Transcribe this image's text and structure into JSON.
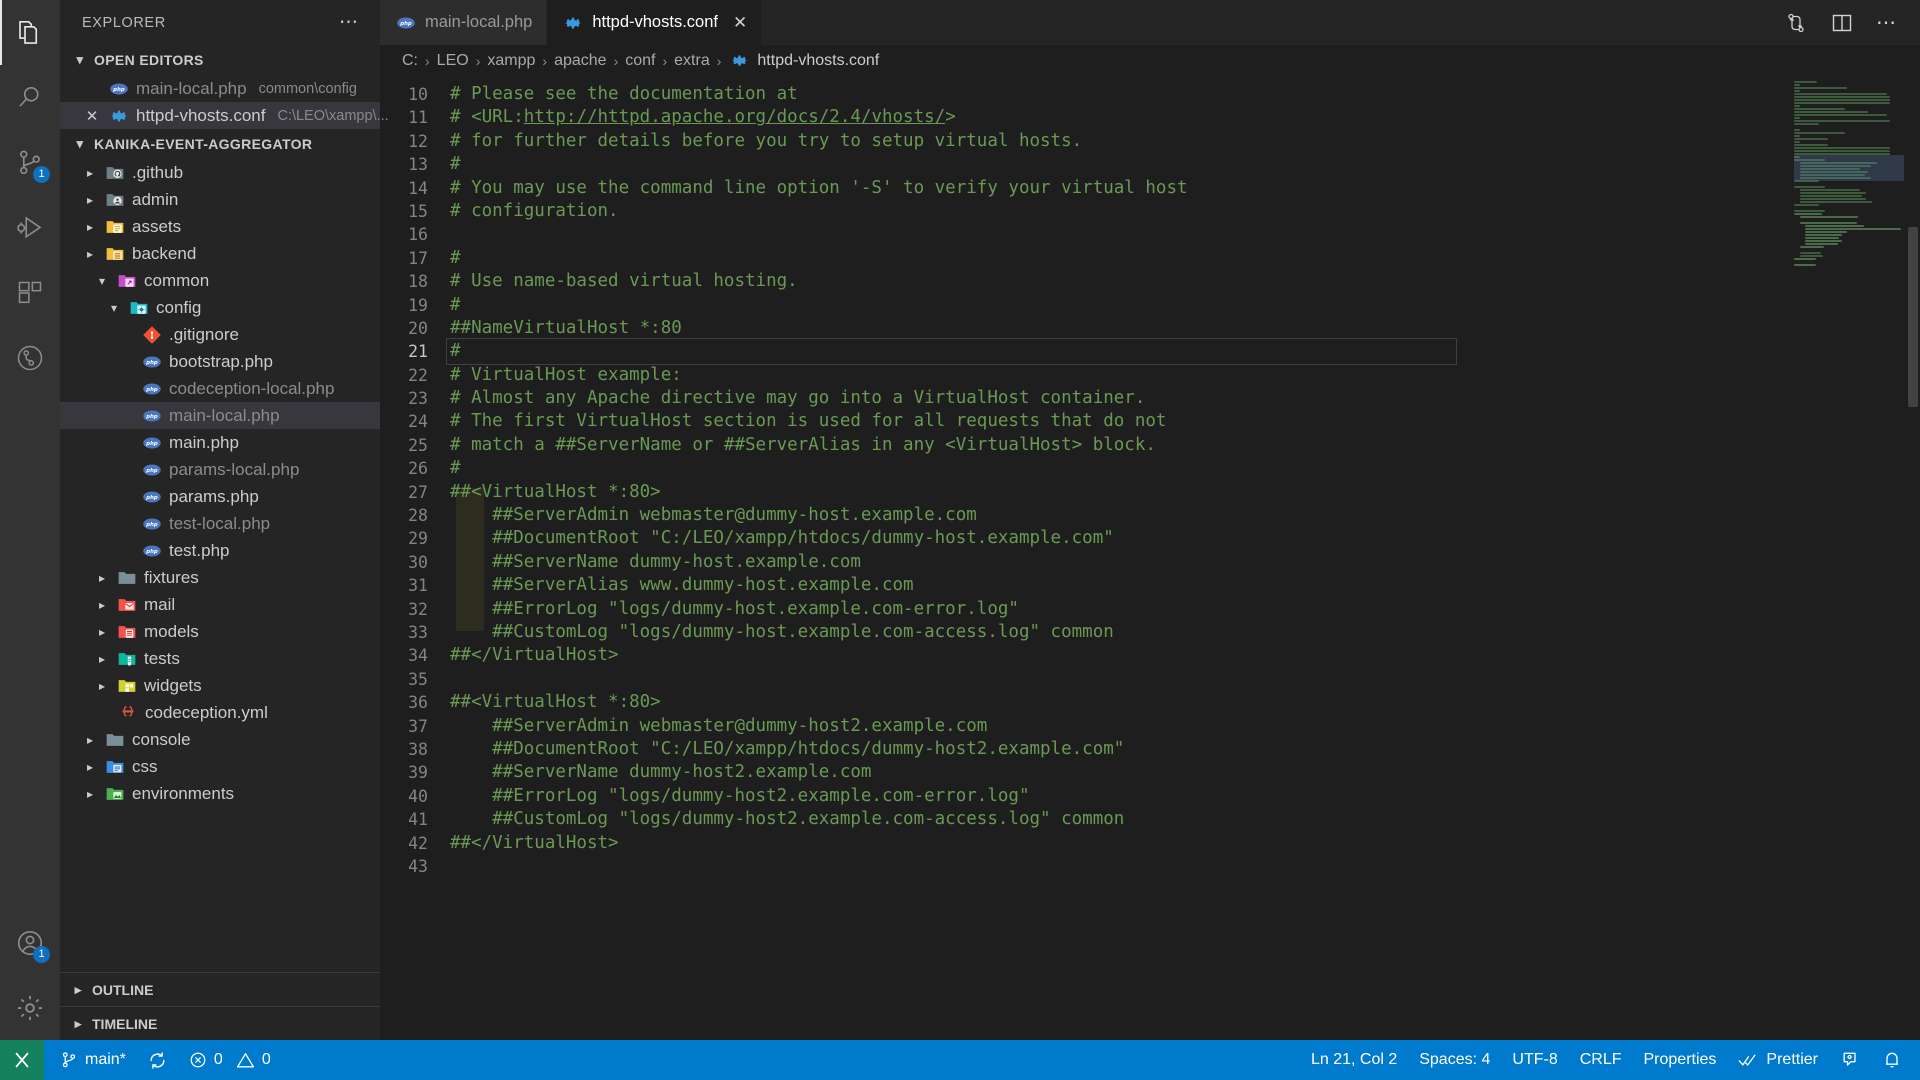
{
  "activity_bar": {
    "items": [
      {
        "name": "explorer-icon",
        "label": "Explorer",
        "active": true,
        "badge": ""
      },
      {
        "name": "search-icon",
        "label": "Search",
        "active": false,
        "badge": ""
      },
      {
        "name": "source-control-icon",
        "label": "Source Control",
        "active": false,
        "badge": "1"
      },
      {
        "name": "run-debug-icon",
        "label": "Run and Debug",
        "active": false,
        "badge": ""
      },
      {
        "name": "extensions-icon",
        "label": "Extensions",
        "active": false,
        "badge": ""
      },
      {
        "name": "git-graph-icon",
        "label": "Git Graph",
        "active": false,
        "badge": ""
      }
    ],
    "bottom_items": [
      {
        "name": "account-icon",
        "label": "Accounts",
        "badge": "1"
      },
      {
        "name": "settings-gear-icon",
        "label": "Manage",
        "badge": ""
      }
    ]
  },
  "sidebar": {
    "title": "EXPLORER",
    "more_actions": "⋯",
    "open_editors": {
      "label": "OPEN EDITORS",
      "expanded": true,
      "items": [
        {
          "name": "main-local.php",
          "detail": "common\\config",
          "icon": "php-icon",
          "dim": true,
          "selected": false,
          "dirty": false
        },
        {
          "name": "httpd-vhosts.conf",
          "detail": "C:\\LEO\\xampp\\...",
          "icon": "gear-icon",
          "dim": false,
          "selected": true,
          "dirty": false
        }
      ]
    },
    "workspace": {
      "label": "KANIKA-EVENT-AGGREGATOR",
      "expanded": true,
      "tree": [
        {
          "label": ".github",
          "type": "folder",
          "icon": "github-folder-icon",
          "indent": 1,
          "expanded": false,
          "dim": false
        },
        {
          "label": "admin",
          "type": "folder",
          "icon": "admin-folder-icon",
          "indent": 1,
          "expanded": false,
          "dim": false
        },
        {
          "label": "assets",
          "type": "folder",
          "icon": "assets-folder-icon",
          "indent": 1,
          "expanded": false,
          "dim": false
        },
        {
          "label": "backend",
          "type": "folder",
          "icon": "backend-folder-icon",
          "indent": 1,
          "expanded": false,
          "dim": false
        },
        {
          "label": "common",
          "type": "folder",
          "icon": "common-folder-icon",
          "indent": 1,
          "expanded": true,
          "dim": false
        },
        {
          "label": "config",
          "type": "folder",
          "icon": "config-folder-icon",
          "indent": 2,
          "expanded": true,
          "dim": false
        },
        {
          "label": ".gitignore",
          "type": "file",
          "icon": "git-icon",
          "indent": 3,
          "dim": false
        },
        {
          "label": "bootstrap.php",
          "type": "file",
          "icon": "php-icon",
          "indent": 3,
          "dim": false
        },
        {
          "label": "codeception-local.php",
          "type": "file",
          "icon": "php-icon",
          "indent": 3,
          "dim": true
        },
        {
          "label": "main-local.php",
          "type": "file",
          "icon": "php-icon",
          "indent": 3,
          "dim": true,
          "selected": true
        },
        {
          "label": "main.php",
          "type": "file",
          "icon": "php-icon",
          "indent": 3,
          "dim": false
        },
        {
          "label": "params-local.php",
          "type": "file",
          "icon": "php-icon",
          "indent": 3,
          "dim": true
        },
        {
          "label": "params.php",
          "type": "file",
          "icon": "php-icon",
          "indent": 3,
          "dim": false
        },
        {
          "label": "test-local.php",
          "type": "file",
          "icon": "php-icon",
          "indent": 3,
          "dim": true
        },
        {
          "label": "test.php",
          "type": "file",
          "icon": "php-icon",
          "indent": 3,
          "dim": false
        },
        {
          "label": "fixtures",
          "type": "folder",
          "icon": "plain-folder-icon",
          "indent": 2,
          "expanded": false,
          "dim": false
        },
        {
          "label": "mail",
          "type": "folder",
          "icon": "mail-folder-icon",
          "indent": 2,
          "expanded": false,
          "dim": false
        },
        {
          "label": "models",
          "type": "folder",
          "icon": "models-folder-icon",
          "indent": 2,
          "expanded": false,
          "dim": false
        },
        {
          "label": "tests",
          "type": "folder",
          "icon": "tests-folder-icon",
          "indent": 2,
          "expanded": false,
          "dim": false
        },
        {
          "label": "widgets",
          "type": "folder",
          "icon": "widgets-folder-icon",
          "indent": 2,
          "expanded": false,
          "dim": false
        },
        {
          "label": "codeception.yml",
          "type": "file",
          "icon": "yaml-icon",
          "indent": 2,
          "dim": false
        },
        {
          "label": "console",
          "type": "folder",
          "icon": "plain-folder-icon",
          "indent": 1,
          "expanded": false,
          "dim": false
        },
        {
          "label": "css",
          "type": "folder",
          "icon": "css-folder-icon",
          "indent": 1,
          "expanded": false,
          "dim": false
        },
        {
          "label": "environments",
          "type": "folder",
          "icon": "env-folder-icon",
          "indent": 1,
          "expanded": false,
          "dim": false
        }
      ]
    },
    "outline_label": "OUTLINE",
    "timeline_label": "TIMELINE"
  },
  "tabs": [
    {
      "label": "main-local.php",
      "icon": "php-icon",
      "active": false,
      "closable": false
    },
    {
      "label": "httpd-vhosts.conf",
      "icon": "gear-icon",
      "active": true,
      "closable": true,
      "close": "✕"
    }
  ],
  "tab_actions": [
    {
      "name": "split-source-control-icon",
      "label": "Open Changes"
    },
    {
      "name": "split-editor-icon",
      "label": "Split Editor Right"
    },
    {
      "name": "more-actions-icon",
      "label": "More Actions..."
    }
  ],
  "breadcrumb": {
    "separator": "›",
    "crumbs": [
      "C:",
      "LEO",
      "xampp",
      "apache",
      "conf",
      "extra"
    ],
    "file": "httpd-vhosts.conf",
    "file_icon": "gear-icon"
  },
  "editor": {
    "first_line_number": 10,
    "current_line": 21,
    "indent_guide_lines": [
      28,
      29,
      30,
      31,
      32,
      33
    ],
    "lines": [
      {
        "n": 10,
        "text": "# Please see the documentation at"
      },
      {
        "n": 11,
        "text": "# <URL:http://httpd.apache.org/docs/2.4/vhosts/>",
        "link": "http://httpd.apache.org/docs/2.4/vhosts/"
      },
      {
        "n": 12,
        "text": "# for further details before you try to setup virtual hosts."
      },
      {
        "n": 13,
        "text": "#"
      },
      {
        "n": 14,
        "text": "# You may use the command line option '-S' to verify your virtual host"
      },
      {
        "n": 15,
        "text": "# configuration."
      },
      {
        "n": 16,
        "text": ""
      },
      {
        "n": 17,
        "text": "#"
      },
      {
        "n": 18,
        "text": "# Use name-based virtual hosting."
      },
      {
        "n": 19,
        "text": "#"
      },
      {
        "n": 20,
        "text": "##NameVirtualHost *:80"
      },
      {
        "n": 21,
        "text": "#"
      },
      {
        "n": 22,
        "text": "# VirtualHost example:"
      },
      {
        "n": 23,
        "text": "# Almost any Apache directive may go into a VirtualHost container."
      },
      {
        "n": 24,
        "text": "# The first VirtualHost section is used for all requests that do not"
      },
      {
        "n": 25,
        "text": "# match a ##ServerName or ##ServerAlias in any <VirtualHost> block."
      },
      {
        "n": 26,
        "text": "#"
      },
      {
        "n": 27,
        "text": "##<VirtualHost *:80>"
      },
      {
        "n": 28,
        "text": "    ##ServerAdmin webmaster@dummy-host.example.com"
      },
      {
        "n": 29,
        "text": "    ##DocumentRoot \"C:/LEO/xampp/htdocs/dummy-host.example.com\""
      },
      {
        "n": 30,
        "text": "    ##ServerName dummy-host.example.com"
      },
      {
        "n": 31,
        "text": "    ##ServerAlias www.dummy-host.example.com"
      },
      {
        "n": 32,
        "text": "    ##ErrorLog \"logs/dummy-host.example.com-error.log\""
      },
      {
        "n": 33,
        "text": "    ##CustomLog \"logs/dummy-host.example.com-access.log\" common"
      },
      {
        "n": 34,
        "text": "##</VirtualHost>"
      },
      {
        "n": 35,
        "text": ""
      },
      {
        "n": 36,
        "text": "##<VirtualHost *:80>"
      },
      {
        "n": 37,
        "text": "    ##ServerAdmin webmaster@dummy-host2.example.com"
      },
      {
        "n": 38,
        "text": "    ##DocumentRoot \"C:/LEO/xampp/htdocs/dummy-host2.example.com\""
      },
      {
        "n": 39,
        "text": "    ##ServerName dummy-host2.example.com"
      },
      {
        "n": 40,
        "text": "    ##ErrorLog \"logs/dummy-host2.example.com-error.log\""
      },
      {
        "n": 41,
        "text": "    ##CustomLog \"logs/dummy-host2.example.com-access.log\" common"
      },
      {
        "n": 42,
        "text": "##</VirtualHost>"
      },
      {
        "n": 43,
        "text": ""
      }
    ]
  },
  "status_bar": {
    "remote_icon": "remote-window-icon",
    "branch": "main*",
    "branch_icon": "source-control-icon",
    "sync_icon": "sync-icon",
    "errors": "0",
    "warnings": "0",
    "error_icon": "error-circle-icon",
    "warning_icon": "warning-triangle-icon",
    "cursor_position": "Ln 21, Col 2",
    "indentation": "Spaces: 4",
    "encoding": "UTF-8",
    "eol": "CRLF",
    "language_mode": "Properties",
    "formatter": "Prettier",
    "formatter_icon": "check-check-icon",
    "live_share_icon": "live-share-icon",
    "notifications_icon": "bell-icon"
  },
  "colors": {
    "accent": "#007acc",
    "remote_green": "#16825d",
    "comment_green": "#6a9955",
    "activity_bg": "#333333",
    "sidebar_bg": "#252526",
    "editor_bg": "#1e1e1e",
    "selection": "#37373d"
  }
}
